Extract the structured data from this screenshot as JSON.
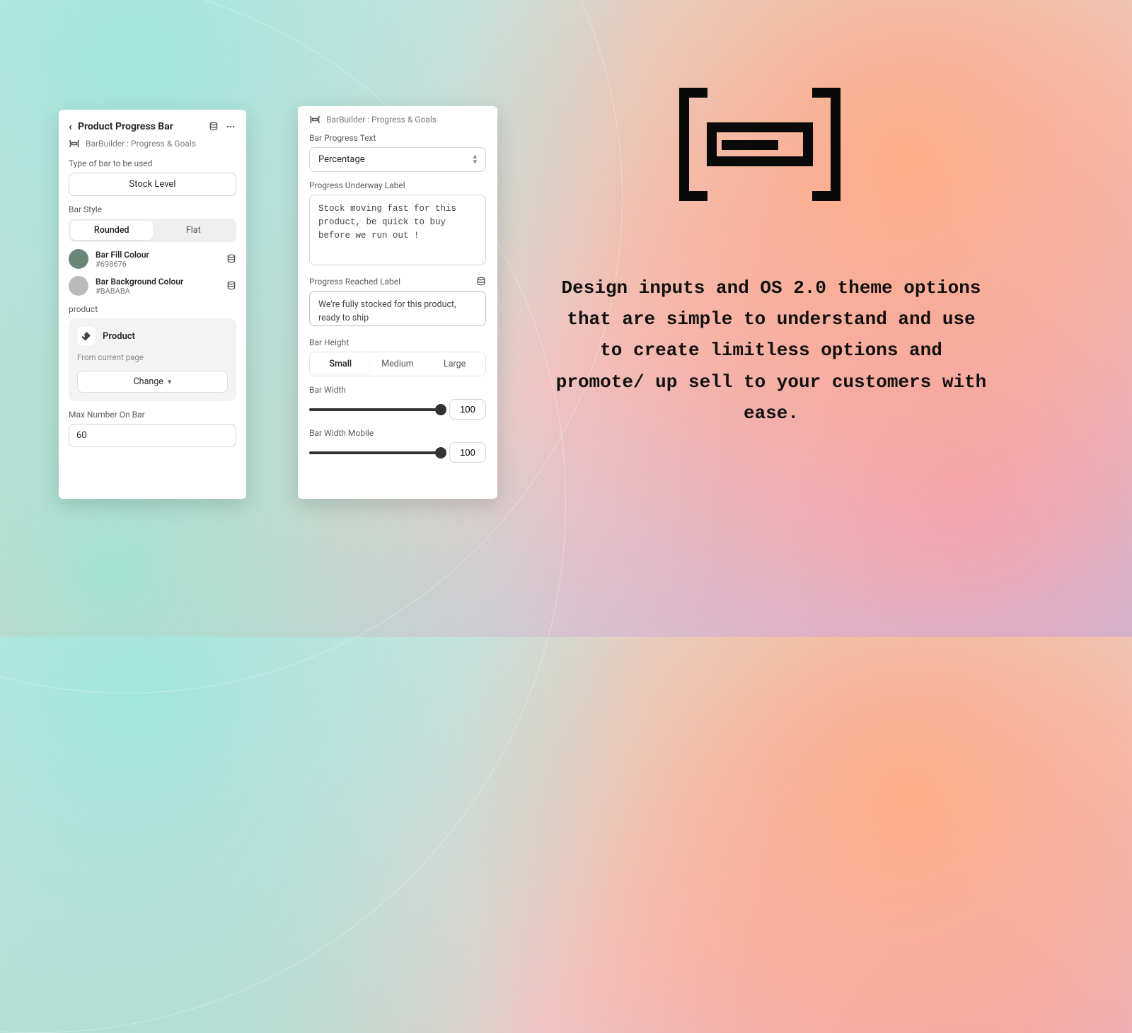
{
  "panel1": {
    "title": "Product Progress Bar",
    "app_label": "BarBuilder : Progress & Goals",
    "type_label": "Type of bar to be used",
    "type_value": "Stock Level",
    "style_label": "Bar Style",
    "style_opts": [
      "Rounded",
      "Flat"
    ],
    "fill": {
      "name": "Bar Fill Colour",
      "hex": "#698676"
    },
    "bg": {
      "name": "Bar Background Colour",
      "hex": "#BABABA"
    },
    "product_label": "product",
    "product_name": "Product",
    "product_sub": "From current page",
    "change_label": "Change",
    "max_label": "Max Number On Bar",
    "max_value": "60"
  },
  "panel2": {
    "app_label": "BarBuilder : Progress & Goals",
    "bpt_label": "Bar Progress Text",
    "bpt_value": "Percentage",
    "pu_label": "Progress Underway Label",
    "pu_value": "Stock moving fast for this product, be quick to buy before we run out !",
    "pr_label": "Progress Reached Label",
    "pr_value": "We're fully stocked for this product, ready to ship",
    "bh_label": "Bar Height",
    "bh_opts": [
      "Small",
      "Medium",
      "Large"
    ],
    "bw_label": "Bar Width",
    "bw_value": "100",
    "bwm_label": "Bar Width Mobile",
    "bwm_value": "100"
  },
  "copy": "Design inputs and OS 2.0 theme options that are simple to understand and use to create limitless options and promote/ up sell to your customers with ease."
}
